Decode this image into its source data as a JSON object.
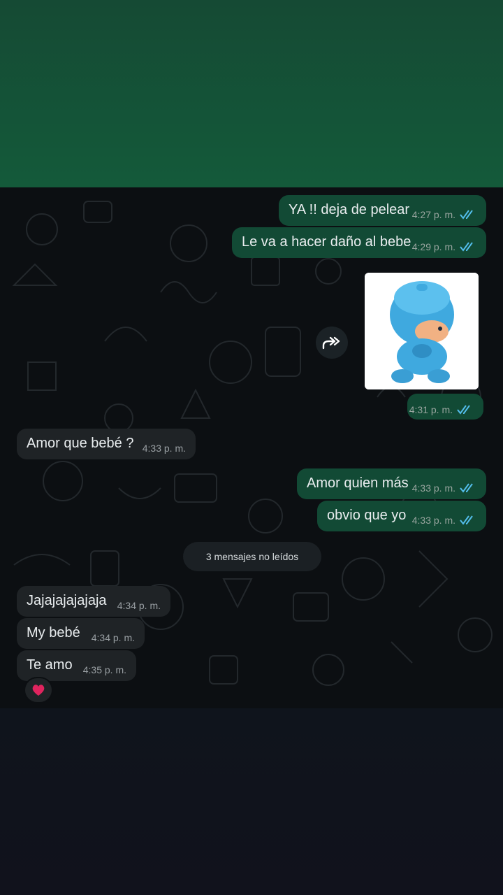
{
  "messages": [
    {
      "text": "YA !! deja de pelear",
      "time": "4:27 p. m."
    },
    {
      "text": "Le va a hacer daño al bebe",
      "time": "4:29 p. m."
    },
    {
      "text": "",
      "time": "4:31 p. m."
    },
    {
      "text": "Amor que bebé ?",
      "time": "4:33 p. m."
    },
    {
      "text": "Amor quien más",
      "time": "4:33 p. m."
    },
    {
      "text": "obvio que yo",
      "time": "4:33 p. m."
    },
    {
      "text": "Jajajajajajaja",
      "time": "4:34 p. m."
    },
    {
      "text": "My bebé",
      "time": "4:34 p. m."
    },
    {
      "text": "Te amo",
      "time": "4:35 p. m."
    }
  ],
  "unread_banner": "3 mensajes no leídos",
  "icons": {
    "read": "double-check-icon",
    "forward": "forward-icon",
    "reaction": "heart-icon"
  },
  "colors": {
    "outgoing": "#124a35",
    "incoming": "#1f2326",
    "read_ticks": "#53bdeb"
  }
}
